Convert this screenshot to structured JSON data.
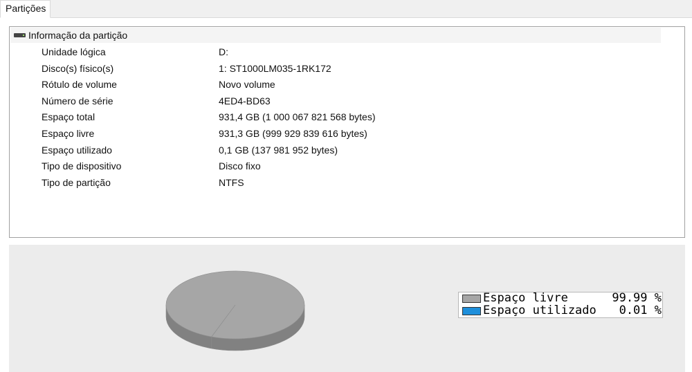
{
  "tabs": [
    {
      "label": "Partições"
    }
  ],
  "partition_info": {
    "header": "Informação da partição",
    "icon": "drive-icon",
    "rows": [
      {
        "label": "Unidade lógica",
        "value": "D:"
      },
      {
        "label": "Disco(s) físico(s)",
        "value": "1: ST1000LM035-1RK172"
      },
      {
        "label": "Rótulo de volume",
        "value": "Novo volume"
      },
      {
        "label": "Número de série",
        "value": "4ED4-BD63"
      },
      {
        "label": "Espaço total",
        "value": "931,4 GB (1 000 067 821 568 bytes)"
      },
      {
        "label": "Espaço livre",
        "value": "931,3 GB (999 929 839 616 bytes)"
      },
      {
        "label": "Espaço utilizado",
        "value": "0,1 GB (137 981 952 bytes)"
      },
      {
        "label": "Tipo de dispositivo",
        "value": "Disco fixo"
      },
      {
        "label": "Tipo de partição",
        "value": "NTFS"
      }
    ]
  },
  "chart_data": {
    "type": "pie",
    "categories": [
      "Espaço livre",
      "Espaço utilizado"
    ],
    "values": [
      99.99,
      0.01
    ],
    "series": [
      {
        "name": "Espaço livre",
        "values": [
          99.99
        ],
        "color": "#a6a6a6"
      },
      {
        "name": "Espaço utilizado",
        "values": [
          0.01
        ],
        "color": "#1e8fdb"
      }
    ],
    "legend": [
      {
        "label": "Espaço livre",
        "percent": "99.99 %",
        "color": "#a6a6a6"
      },
      {
        "label": "Espaço utilizado",
        "percent": "0.01 %",
        "color": "#1e8fdb"
      }
    ],
    "title": "",
    "legend_position": "right",
    "style": "3d"
  }
}
